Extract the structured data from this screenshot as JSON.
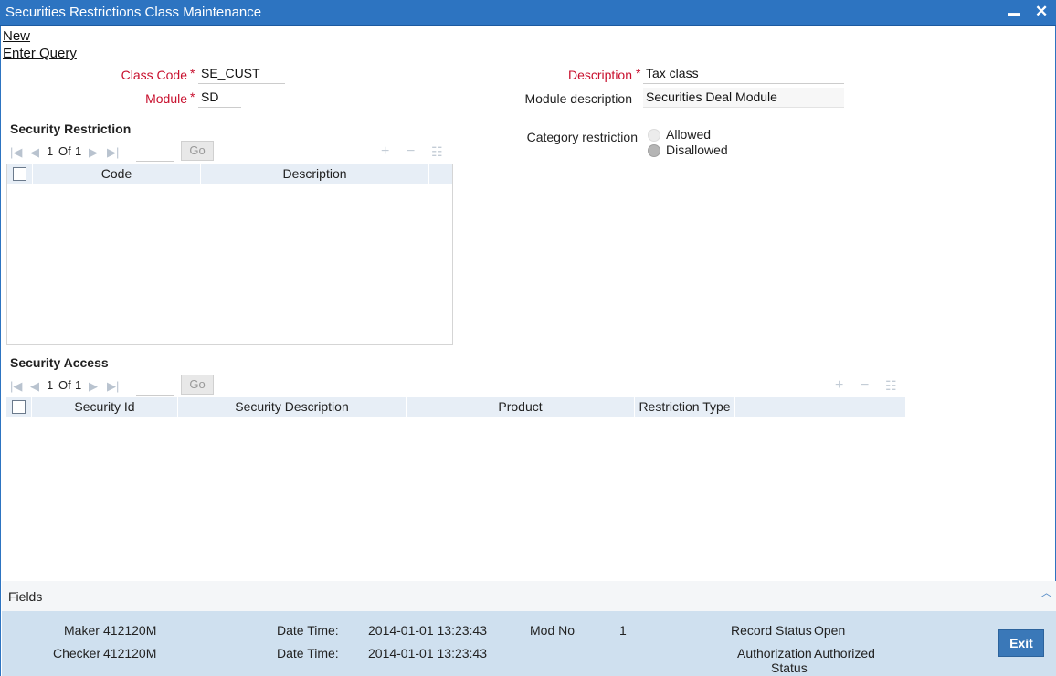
{
  "window": {
    "title": "Securities Restrictions Class Maintenance",
    "minimize_glyph": "▬",
    "close_glyph": "✕"
  },
  "actions": {
    "new": "New",
    "enter_query": "Enter Query"
  },
  "form": {
    "class_code_label": "Class Code",
    "class_code_value": "SE_CUST",
    "module_label": "Module",
    "module_value": "SD",
    "description_label": "Description",
    "description_value": "Tax class",
    "module_description_label": "Module description",
    "module_description_value": "Securities Deal Module",
    "required_mark": "*",
    "category_restriction_label": "Category restriction",
    "category_options": [
      "Allowed",
      "Disallowed"
    ],
    "category_selected": "Disallowed"
  },
  "security_restriction": {
    "title": "Security Restriction",
    "page": "1",
    "of_label": "Of",
    "total": "1",
    "go_label": "Go",
    "columns": [
      "Code",
      "Description"
    ]
  },
  "security_access": {
    "title": "Security Access",
    "page": "1",
    "of_label": "Of",
    "total": "1",
    "go_label": "Go",
    "columns": [
      "Security Id",
      "Security Description",
      "Product",
      "Restriction Type"
    ]
  },
  "fields_bar": {
    "label": "Fields"
  },
  "audit": {
    "maker_label": "Maker",
    "maker_value": "412120M",
    "checker_label": "Checker",
    "checker_value": "412120M",
    "datetime_label": "Date Time:",
    "maker_datetime": "2014-01-01 13:23:43",
    "checker_datetime": "2014-01-01 13:23:43",
    "mod_no_label": "Mod No",
    "mod_no_value": "1",
    "record_status_label": "Record Status",
    "record_status_value": "Open",
    "authorization_label": "Authorization",
    "status_label": "Status",
    "authorization_value": "Authorized",
    "exit_label": "Exit"
  },
  "colors": {
    "titlebar": "#2d74c1",
    "required": "#c8102e",
    "grid_header": "#e7eef6",
    "audit_bg": "#cfe0ef",
    "exit_button": "#3a78b8"
  }
}
